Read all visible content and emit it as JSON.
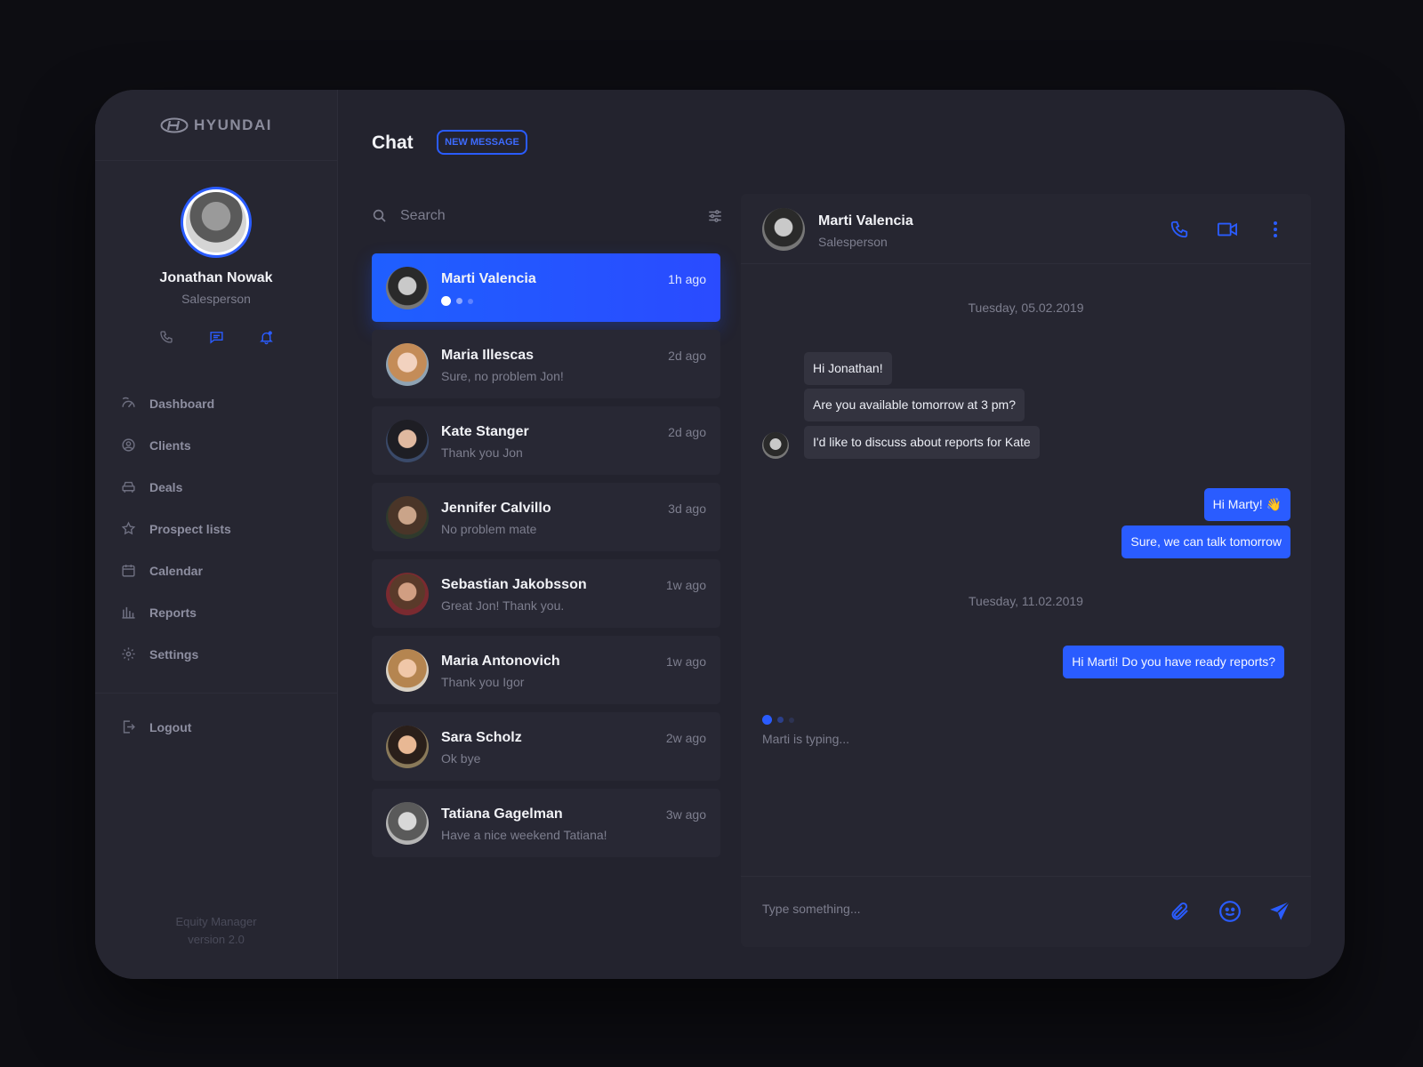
{
  "brand": {
    "name": "HYUNDAI",
    "icon": "hyundai-logo"
  },
  "colors": {
    "accent": "#2a5cff",
    "background": "#0d0d12",
    "panel": "#23232e",
    "card": "#282834"
  },
  "user": {
    "name": "Jonathan Nowak",
    "role": "Salesperson"
  },
  "quick_icons": [
    "phone-icon",
    "chat-icon",
    "bell-icon"
  ],
  "nav": [
    {
      "label": "Dashboard",
      "icon": "dashboard-icon"
    },
    {
      "label": "Clients",
      "icon": "clients-icon"
    },
    {
      "label": "Deals",
      "icon": "car-icon"
    },
    {
      "label": "Prospect lists",
      "icon": "star-icon"
    },
    {
      "label": "Calendar",
      "icon": "calendar-icon"
    },
    {
      "label": "Reports",
      "icon": "bar-chart-icon"
    },
    {
      "label": "Settings",
      "icon": "gear-icon"
    }
  ],
  "logout": {
    "label": "Logout",
    "icon": "logout-icon"
  },
  "app_info": {
    "line1": "Equity Manager",
    "line2": "version 2.0"
  },
  "chat": {
    "title": "Chat",
    "new_message_label": "NEW MESSAGE"
  },
  "search": {
    "placeholder": "Search"
  },
  "conversations": [
    {
      "name": "Marti Valencia",
      "message": "",
      "time": "1h ago",
      "active": true,
      "typing": true
    },
    {
      "name": "Maria Illescas",
      "message": "Sure, no problem Jon!",
      "time": "2d ago"
    },
    {
      "name": "Kate Stanger",
      "message": "Thank you Jon",
      "time": "2d ago"
    },
    {
      "name": "Jennifer Calvillo",
      "message": "No problem mate",
      "time": "3d ago"
    },
    {
      "name": "Sebastian Jakobsson",
      "message": "Great Jon! Thank you.",
      "time": "1w ago"
    },
    {
      "name": "Maria Antonovich",
      "message": "Thank you Igor",
      "time": "1w ago"
    },
    {
      "name": "Sara Scholz",
      "message": "Ok bye",
      "time": "2w ago"
    },
    {
      "name": "Tatiana Gagelman",
      "message": "Have a nice weekend Tatiana!",
      "time": "3w ago"
    }
  ],
  "thread": {
    "contact_name": "Marti Valencia",
    "contact_role": "Salesperson",
    "header_icons": [
      "phone-icon",
      "video-icon",
      "more-vertical-icon"
    ],
    "date1": "Tuesday, 05.02.2019",
    "incoming": [
      "Hi Jonathan!",
      "Are you available tomorrow at 3 pm?",
      "I'd like to discuss about reports for Kate"
    ],
    "outgoing1": [
      "Hi Marty! 👋",
      "Sure, we can talk tomorrow"
    ],
    "date2": "Tuesday, 11.02.2019",
    "outgoing2": [
      "Hi Marti! Do you have ready reports?"
    ],
    "typing_text": "Marti is typing..."
  },
  "composer": {
    "placeholder": "Type something...",
    "icons": [
      "attachment-icon",
      "emoji-icon",
      "send-icon"
    ]
  }
}
